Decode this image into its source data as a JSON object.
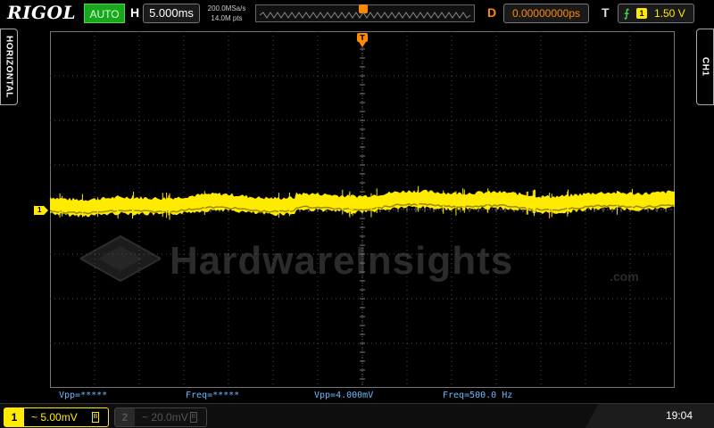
{
  "header": {
    "brand": "RIGOL",
    "run_mode": "AUTO",
    "horizontal_label": "H",
    "timebase": "5.000ms",
    "sample_rate": "200.0MSa/s",
    "memory_depth": "14.0M pts",
    "delay_label": "D",
    "delay": "0.00000000ps",
    "trigger_label": "T",
    "trigger_source": "1",
    "trigger_level": "1.50 V",
    "trigger_edge_icon": "rising-edge-icon"
  },
  "side_tabs": {
    "left": "HORIZONTAL",
    "right": "CH1"
  },
  "screen": {
    "channel_marker": "1",
    "trace_color": "#ffeb00",
    "grid_color": "#4a4a4a",
    "watermark": "HardwareInsights",
    "watermark_suffix": ".com"
  },
  "measurements": [
    {
      "label": "Vpp=*****"
    },
    {
      "label": "Freq=*****"
    },
    {
      "label": "Vpp=4.000mV"
    },
    {
      "label": "Freq=500.0 Hz"
    }
  ],
  "footer": {
    "ch1": {
      "number": "1",
      "coupling_icon": "ac-coupling-icon",
      "scale": "~ 5.00mV",
      "bw_icon": "bandwidth-limit-icon",
      "bw": "B"
    },
    "ch2": {
      "number": "2",
      "scale": "~ 20.0mV",
      "bw": "B"
    },
    "clock": "19:04"
  }
}
